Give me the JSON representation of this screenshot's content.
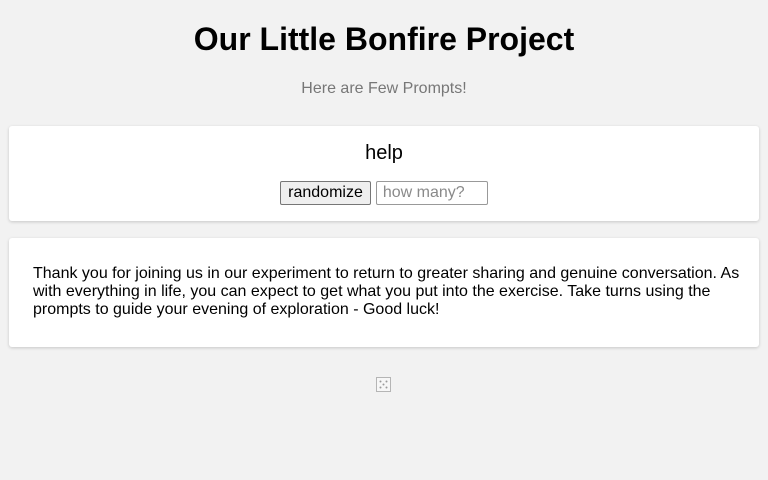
{
  "header": {
    "title": "Our Little Bonfire Project",
    "subtitle": "Here are Few Prompts!"
  },
  "prompt_card": {
    "prompt": "help",
    "randomize_label": "randomize",
    "count_placeholder": "how many?",
    "count_value": ""
  },
  "intro": {
    "text": "Thank you for joining us in our experiment to return to greater sharing and genuine conversation. As with everything in life, you can expect to get what you put into the exercise. Take turns using the prompts to guide your evening of exploration - Good luck!"
  },
  "footer": {
    "icon": "dice-icon"
  },
  "colors": {
    "background": "#f2f2f2",
    "card": "#ffffff",
    "subtitle": "#777777"
  }
}
